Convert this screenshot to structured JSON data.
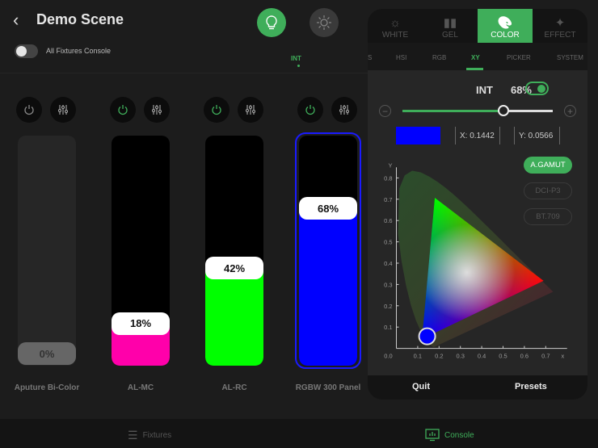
{
  "header": {
    "title": "Demo Scene",
    "toggle_label": "All Fixtures Console",
    "all_fixtures_on": false,
    "mode_label": "INT"
  },
  "fixtures": [
    {
      "name": "Aputure Bi-Color",
      "value": 0,
      "label": "0%",
      "color": "#888888",
      "enabled": false
    },
    {
      "name": "AL-MC",
      "value": 18,
      "label": "18%",
      "color": "#ff00aa",
      "enabled": true
    },
    {
      "name": "AL-RC",
      "value": 42,
      "label": "42%",
      "color": "#00ff00",
      "enabled": true
    },
    {
      "name": "RGBW 300 Panel",
      "value": 68,
      "label": "68%",
      "color": "#0000ff",
      "enabled": true,
      "selected": true
    }
  ],
  "panel": {
    "tabs": [
      "WHITE",
      "GEL",
      "COLOR",
      "EFFECT"
    ],
    "active_tab": "COLOR",
    "subtabs": [
      "S",
      "HSI",
      "RGB",
      "XY",
      "PICKER",
      "SYSTEM"
    ],
    "active_subtab": "XY",
    "int_label": "INT",
    "int_value": "68%",
    "int_percent": 68,
    "int_on": true,
    "swatch_color": "#0000ff",
    "x_field": "X: 0.1442",
    "y_field": "Y: 0.0566",
    "gamuts": [
      "A.GAMUT",
      "DCI-P3",
      "BT.709"
    ],
    "active_gamut": "A.GAMUT",
    "quit": "Quit",
    "presets": "Presets"
  },
  "chart_data": {
    "type": "scatter",
    "xlabel": "x",
    "ylabel": "Y",
    "xlim": [
      0,
      0.8
    ],
    "ylim": [
      0,
      0.85
    ],
    "x_ticks": [
      "0.0",
      "0.1",
      "0.2",
      "0.3",
      "0.4",
      "0.5",
      "0.6",
      "0.7",
      "x"
    ],
    "y_ticks": [
      "0.1",
      "0.2",
      "0.3",
      "0.4",
      "0.5",
      "0.6",
      "0.7",
      "0.8",
      "Y"
    ],
    "gamut_triangle": [
      [
        0.18,
        0.707
      ],
      [
        0.69,
        0.317
      ],
      [
        0.12,
        0.044
      ]
    ],
    "point": [
      0.1442,
      0.0566
    ]
  },
  "nav": {
    "fixtures": "Fixtures",
    "console": "Console",
    "active": "Console"
  },
  "colors": {
    "accent": "#3fae5a"
  }
}
